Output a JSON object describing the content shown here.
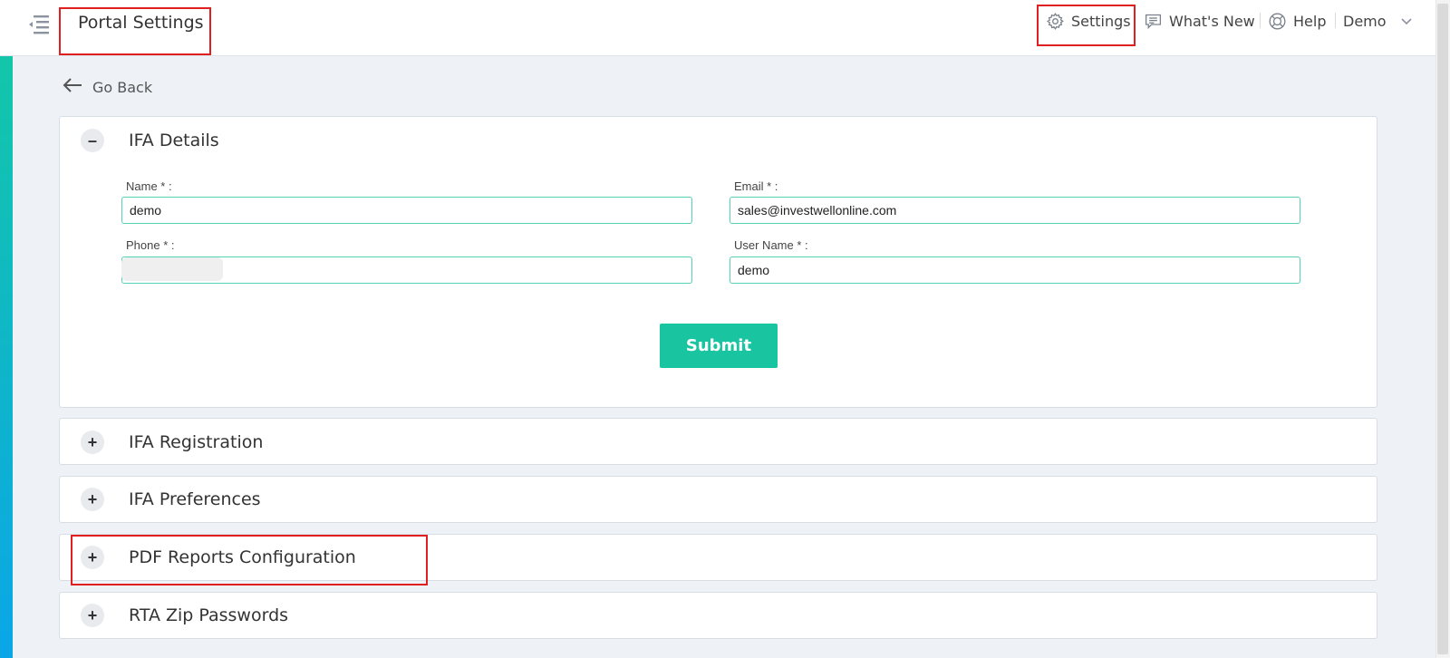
{
  "header": {
    "title": "Portal Settings",
    "nav": {
      "settings": "Settings",
      "whats_new": "What's New",
      "help": "Help",
      "user": "Demo"
    }
  },
  "go_back": "Go Back",
  "panels": {
    "ifa_details": {
      "title": "IFA Details",
      "toggle": "–",
      "fields": {
        "name": {
          "label": "Name * :",
          "value": "demo"
        },
        "email": {
          "label": "Email * :",
          "value": "sales@investwellonline.com"
        },
        "phone": {
          "label": "Phone * :",
          "value": ""
        },
        "username": {
          "label": "User Name * :",
          "value": "demo"
        }
      },
      "submit": "Submit"
    },
    "ifa_registration": {
      "title": "IFA Registration",
      "toggle": "+"
    },
    "ifa_preferences": {
      "title": "IFA Preferences",
      "toggle": "+"
    },
    "pdf_reports": {
      "title": "PDF Reports Configuration",
      "toggle": "+"
    },
    "rta_zip": {
      "title": "RTA Zip Passwords",
      "toggle": "+"
    }
  },
  "colors": {
    "accent": "#19c5a0",
    "highlight": "#e02020",
    "input_border": "#55d1b6"
  }
}
